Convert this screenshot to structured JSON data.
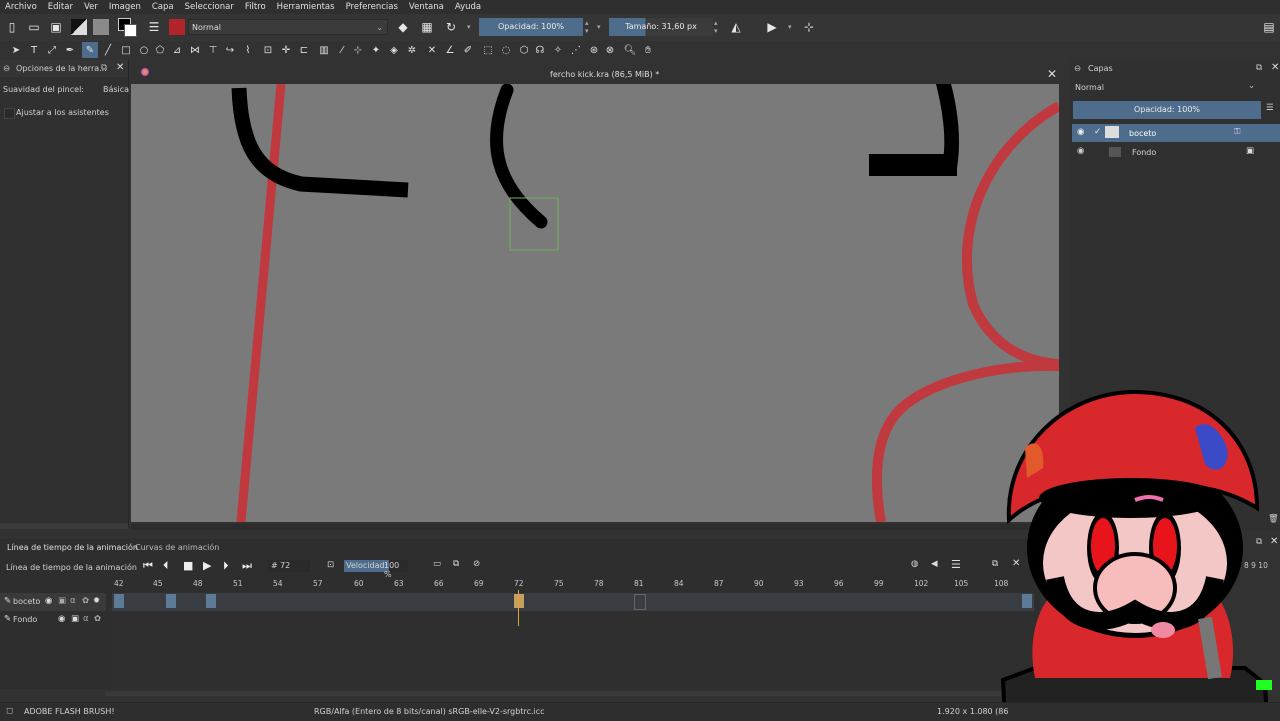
{
  "menu": [
    "Archivo",
    "Editar",
    "Ver",
    "Imagen",
    "Capa",
    "Seleccionar",
    "Filtro",
    "Herramientas",
    "Preferencias",
    "Ventana",
    "Ayuda"
  ],
  "toolbar": {
    "blend_mode": "Normal",
    "opacity_label": "Opacidad: 100%",
    "size_label": "Tamaño: 31,60 px"
  },
  "tool_options": {
    "title": "Opciones de la herra...",
    "smoothing_label": "Suavidad del pincel:",
    "smoothing_value": "Básica",
    "assist_label": "Ajustar a los asistentes"
  },
  "document": {
    "title": "fercho kick.kra (86,5 MiB) *"
  },
  "layers": {
    "title": "Capas",
    "blend_mode": "Normal",
    "opacity_label": "Opacidad:  100%",
    "items": [
      {
        "name": "boceto"
      },
      {
        "name": "Fondo"
      }
    ]
  },
  "timeline": {
    "tabs": [
      "Línea de tiempo de la animación",
      "Curvas de animación"
    ],
    "panel_title": "Línea de tiempo de la animación",
    "frame_prefix": "#",
    "current_frame": "72",
    "speed_label": "Velocidad:",
    "speed_value": "100 %",
    "ruler": [
      "42",
      "45",
      "48",
      "51",
      "54",
      "57",
      "60",
      "63",
      "66",
      "69",
      "72",
      "75",
      "78",
      "81",
      "84",
      "87",
      "90",
      "93",
      "96",
      "99",
      "102",
      "105",
      "108"
    ],
    "right_ruler": "8  9  10",
    "layers": [
      "boceto",
      "Fondo"
    ]
  },
  "status": {
    "brush": "ADOBE FLASH BRUSH!",
    "color_space": "RGB/Alfa (Entero de 8 bits/canal)  sRGB-elle-V2-srgbtrc.icc",
    "dimensions": "1.920 x 1.080 (86"
  },
  "colors": {
    "accent": "#4e6d8d",
    "canvas": "#7a7a7a",
    "stroke_red": "#c0393f",
    "stroke_black": "#000000"
  }
}
